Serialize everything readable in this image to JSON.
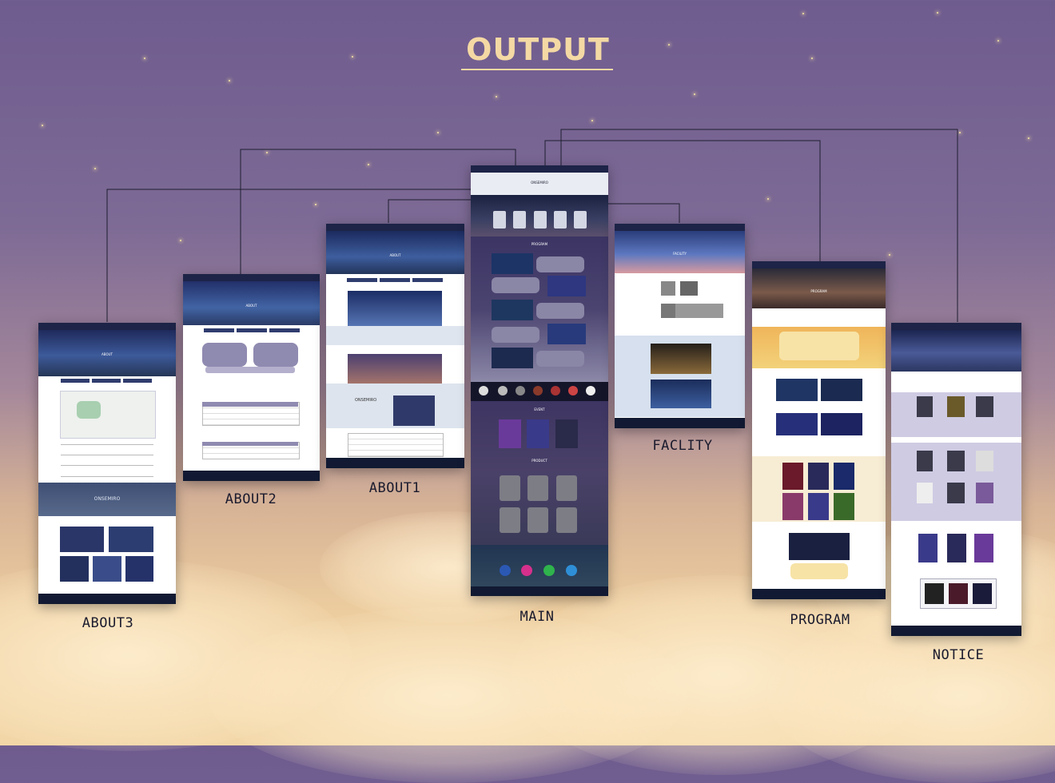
{
  "title": "OUTPUT",
  "pages": {
    "about3": {
      "label": "ABOUT3",
      "hero_title": "ABOUT",
      "brand": "ONSEMIRO"
    },
    "about2": {
      "label": "ABOUT2",
      "hero_title": "ABOUT"
    },
    "about1": {
      "label": "ABOUT1",
      "hero_title": "ABOUT",
      "brand": "ONSEMIRO"
    },
    "main": {
      "label": "MAIN",
      "brand": "ONSEMIRO",
      "section_program": "PROGRAM",
      "section_event": "EVENT",
      "section_product": "PRODUCT"
    },
    "facility": {
      "label": "FACLITY",
      "hero_title": "FACILITY"
    },
    "program": {
      "label": "PROGRAM",
      "hero_title": "PROGRAM"
    },
    "notice": {
      "label": "NOTICE"
    }
  },
  "colors": {
    "accent": "#f4d9a4",
    "nav": "#1d2447",
    "connector": "#1e1e30"
  }
}
